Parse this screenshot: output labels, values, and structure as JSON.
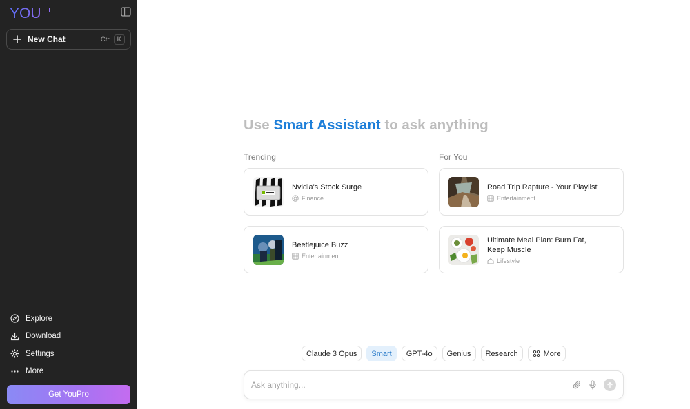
{
  "app": {
    "logo_text": "YOU",
    "brand_color": "#6b6bf0"
  },
  "sidebar": {
    "new_chat": {
      "label": "New Chat",
      "shortcut_mod": "Ctrl",
      "shortcut_key": "K"
    },
    "nav": [
      {
        "label": "Explore",
        "icon": "compass-icon"
      },
      {
        "label": "Download",
        "icon": "download-icon"
      },
      {
        "label": "Settings",
        "icon": "gear-icon"
      },
      {
        "label": "More",
        "icon": "more-dots-icon"
      }
    ],
    "get_pro": "Get YouPro"
  },
  "main": {
    "headline": {
      "prefix": "Use ",
      "accent": "Smart Assistant",
      "suffix": " to ask anything"
    },
    "accent_color": "#1e7fd9",
    "trending": {
      "title": "Trending",
      "cards": [
        {
          "title": "Nvidia's Stock Surge",
          "category": "Finance",
          "category_icon": "coin-icon"
        },
        {
          "title": "Beetlejuice Buzz",
          "category": "Entertainment",
          "category_icon": "film-icon"
        }
      ]
    },
    "for_you": {
      "title": "For You",
      "cards": [
        {
          "title": "Road Trip Rapture - Your Playlist",
          "category": "Entertainment",
          "category_icon": "film-icon"
        },
        {
          "title": "Ultimate Meal Plan: Burn Fat, Keep Muscle",
          "category": "Lifestyle",
          "category_icon": "home-icon"
        }
      ]
    },
    "models": [
      {
        "label": "Claude 3 Opus",
        "active": false
      },
      {
        "label": "Smart",
        "active": true
      },
      {
        "label": "GPT-4o",
        "active": false
      },
      {
        "label": "Genius",
        "active": false
      },
      {
        "label": "Research",
        "active": false
      },
      {
        "label": "More",
        "active": false
      }
    ],
    "ask": {
      "placeholder": "Ask anything...",
      "value": ""
    }
  }
}
